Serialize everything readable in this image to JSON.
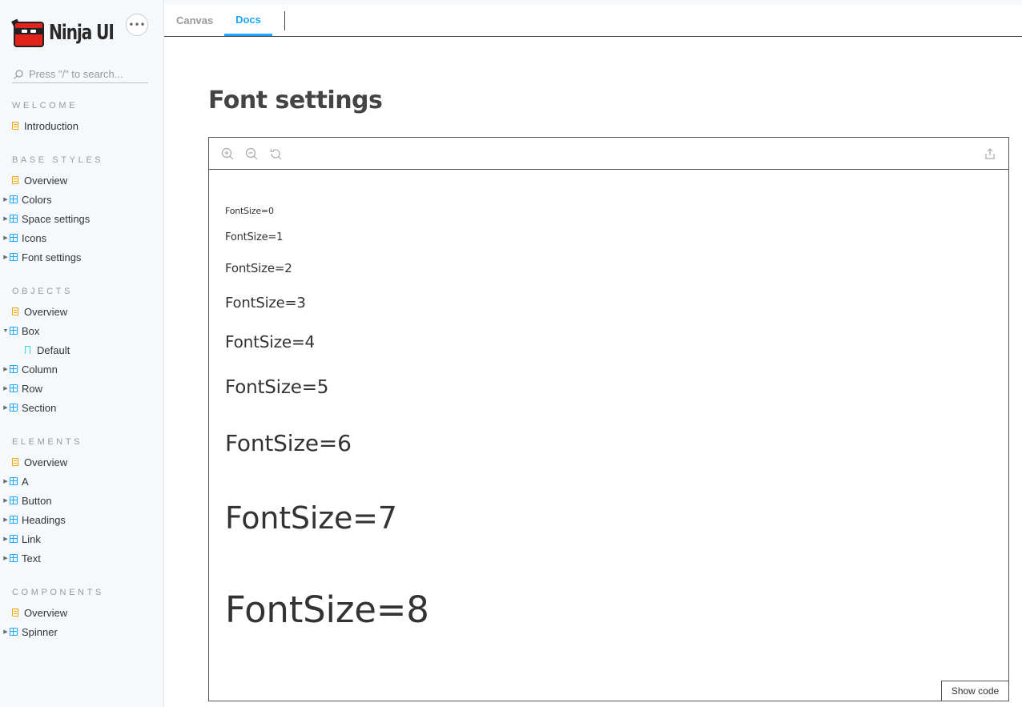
{
  "brand": {
    "name": "Ninja UI"
  },
  "sidebar": {
    "more_label": "•••",
    "search_placeholder": "Press \"/\" to search...",
    "sections": {
      "welcome": "WELCOME",
      "base_styles": "BASE STYLES",
      "objects": "OBJECTS",
      "elements": "ELEMENTS",
      "components": "COMPONENTS"
    },
    "items": {
      "introduction": "Introduction",
      "base_overview": "Overview",
      "colors": "Colors",
      "space_settings": "Space settings",
      "icons": "Icons",
      "font_settings": "Font settings",
      "objects_overview": "Overview",
      "box": "Box",
      "box_default": "Default",
      "column": "Column",
      "row": "Row",
      "section": "Section",
      "elements_overview": "Overview",
      "a": "A",
      "button": "Button",
      "headings": "Headings",
      "link": "Link",
      "text": "Text",
      "components_overview": "Overview",
      "spinner": "Spinner"
    }
  },
  "tabs": {
    "canvas": "Canvas",
    "docs": "Docs"
  },
  "main": {
    "title": "Font settings",
    "rows": [
      "FontSize=0",
      "FontSize=1",
      "FontSize=2",
      "FontSize=3",
      "FontSize=4",
      "FontSize=5",
      "FontSize=6",
      "FontSize=7",
      "FontSize=8"
    ],
    "show_code": "Show code"
  },
  "colors": {
    "accent": "#1ea7fd",
    "doc_icon": "#f2a400",
    "story_icon": "#37d5d3"
  }
}
